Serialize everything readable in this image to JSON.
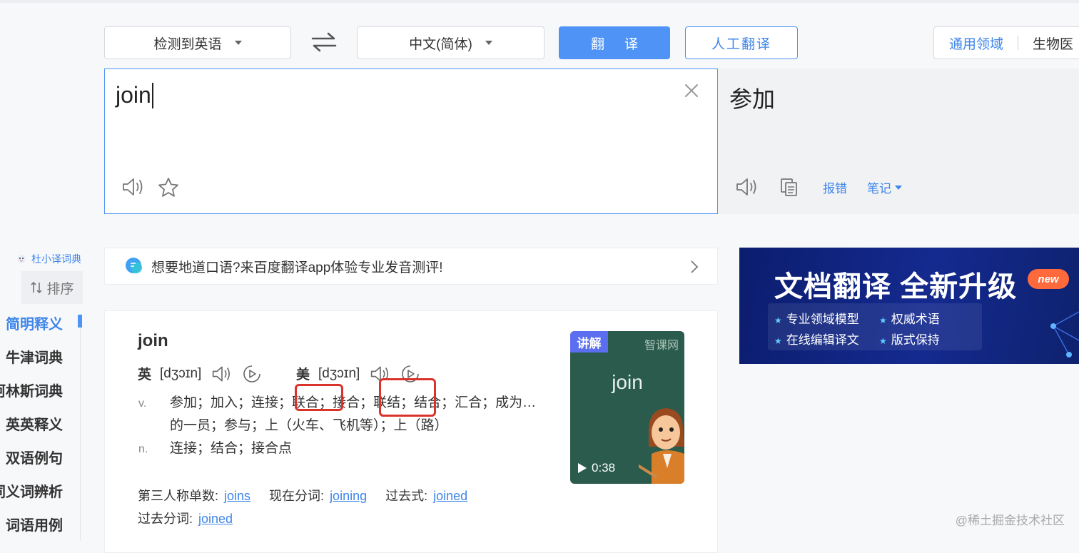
{
  "toolbar": {
    "source_lang": "检测到英语",
    "target_lang": "中文(简体)",
    "translate_button": "翻译",
    "human_translate_button": "人工翻译",
    "domain_active": "通用领域",
    "domain_other": "生物医"
  },
  "input": {
    "text": "join"
  },
  "output": {
    "text": "参加",
    "report_link": "报错",
    "notes_menu": "笔记"
  },
  "sidebar": {
    "brand": "杜小译词典",
    "sort_label": "排序",
    "items": [
      "简明释义",
      "牛津词典",
      "柯林斯词典",
      "英英释义",
      "双语例句",
      "同义词辨析",
      "词语用例"
    ]
  },
  "banner": {
    "text": "想要地道口语?来百度翻译app体验专业发音测评!"
  },
  "dict": {
    "word": "join",
    "uk_label": "英",
    "uk_ipa": "[dʒɔɪn]",
    "us_label": "美",
    "us_ipa": "[dʒɔɪn]",
    "senses": [
      {
        "pos": "v.",
        "parts": [
          "参加；",
          "加入；",
          "连接；",
          "联合；",
          "接合；",
          "联结；",
          "结合；",
          "汇合；",
          "成为…的一员；",
          "参与；",
          "上（火车、飞机等）；",
          "上（路）"
        ]
      },
      {
        "pos": "n.",
        "parts": [
          "连接；",
          "结合；",
          "接合点"
        ]
      }
    ],
    "forms": {
      "third_person_label": "第三人称单数:",
      "third_person": "joins",
      "present_participle_label": "现在分词:",
      "present_participle": "joining",
      "past_tense_label": "过去式:",
      "past_tense": "joined",
      "past_participle_label": "过去分词:",
      "past_participle": "joined"
    }
  },
  "video": {
    "tag": "讲解",
    "source": "智课网",
    "word": "join",
    "duration": "0:38"
  },
  "ad": {
    "title": "文档翻译 全新升级",
    "badge": "new",
    "features": [
      "专业领域模型",
      "权威术语",
      "在线编辑译文",
      "版式保持"
    ]
  },
  "watermark": "@稀土掘金技术社区",
  "colors": {
    "accent": "#4e93f5",
    "highlight_box": "#d9342b",
    "ad_bg": "#142a8f"
  }
}
